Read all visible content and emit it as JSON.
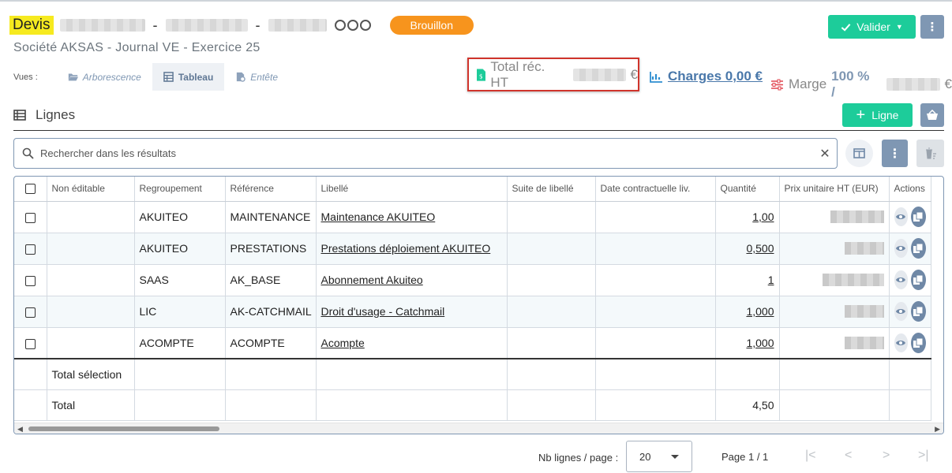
{
  "header": {
    "doc_type": "Devis",
    "separator": "-",
    "status": "Brouillon",
    "subtitle": "Société AKSAS  -  Journal VE  -  Exercice 25",
    "validate_label": "Valider"
  },
  "views": {
    "label": "Vues :",
    "items": [
      {
        "label": "Arborescence",
        "icon": "folder-open-icon"
      },
      {
        "label": "Tableau",
        "icon": "table-icon"
      },
      {
        "label": "Entête",
        "icon": "document-icon"
      }
    ]
  },
  "totals": {
    "total_label": "Total réc. HT",
    "currency": "€",
    "charges_label": "Charges 0,00 €",
    "marge_label": "Marge",
    "marge_value": "100 % /"
  },
  "section": {
    "title": "Lignes",
    "add_label": "Ligne",
    "search_placeholder": "Rechercher dans les résultats"
  },
  "table": {
    "columns": [
      "Non éditable",
      "Regroupement",
      "Référence",
      "Libellé",
      "Suite de libellé",
      "Date contractuelle liv.",
      "Quantité",
      "Prix unitaire HT (EUR)",
      "Actions"
    ],
    "rows": [
      {
        "regroupement": "AKUITEO",
        "reference": "MAINTENANCE",
        "libelle": "Maintenance AKUITEO",
        "quantite": "1,00"
      },
      {
        "regroupement": "AKUITEO",
        "reference": "PRESTATIONS",
        "libelle": "Prestations déploiement AKUITEO",
        "quantite": "0,500"
      },
      {
        "regroupement": "SAAS",
        "reference": "AK_BASE",
        "libelle": "Abonnement Akuiteo",
        "quantite": "1"
      },
      {
        "regroupement": "LIC",
        "reference": "AK-CATCHMAIL",
        "libelle": "Droit d'usage - Catchmail",
        "quantite": "1,000"
      },
      {
        "regroupement": "ACOMPTE",
        "reference": "ACOMPTE",
        "libelle": "Acompte",
        "quantite": "1,000"
      }
    ],
    "total_selection_label": "Total sélection",
    "total_label": "Total",
    "total_quantite": "4,50"
  },
  "pager": {
    "rows_label": "Nb lignes / page :",
    "rows_value": "20",
    "page_label": "Page 1 / 1"
  },
  "colors": {
    "accent_green": "#1dcc9a",
    "status_orange": "#f7941d",
    "slate": "#7f97b3",
    "highlight_yellow": "#f6ea1f",
    "box_red": "#d0342c"
  }
}
